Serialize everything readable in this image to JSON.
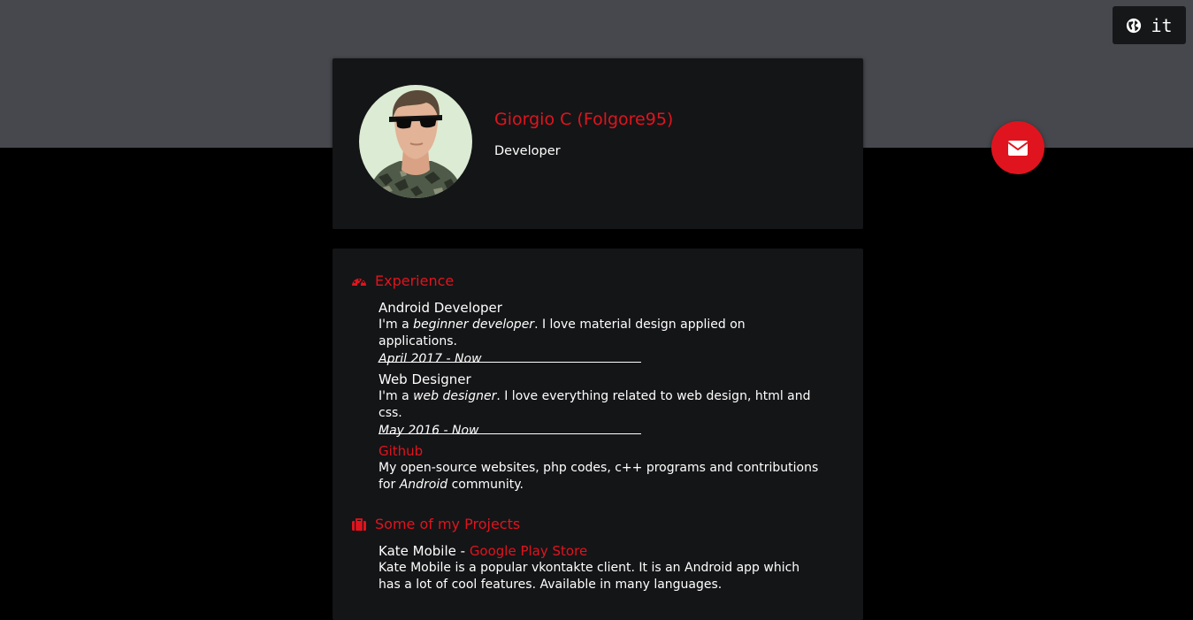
{
  "language": {
    "label": "it",
    "icon": "globe-icon"
  },
  "profile": {
    "name": "Giorgio C (Folgore95)",
    "role": "Developer"
  },
  "contact": {
    "icon": "envelope-icon"
  },
  "experience": {
    "title": "Experience",
    "icon": "dashboard-icon",
    "items": [
      {
        "title": "Android Developer",
        "desc_prefix": "I'm a ",
        "desc_emphasis": "beginner developer",
        "desc_suffix": ". I love material design applied on applications.",
        "date": "April 2017 - Now"
      },
      {
        "title": "Web Designer",
        "desc_prefix": "I'm a ",
        "desc_emphasis": "web designer",
        "desc_suffix": ". I love everything related to web design, html and css.",
        "date": "May 2016 - Now"
      }
    ],
    "github": {
      "label": "Github",
      "desc_prefix": "My open-source websites, php codes, c++ programs and contributions for ",
      "desc_emphasis": "Android",
      "desc_suffix": " community."
    }
  },
  "projects": {
    "title": "Some of my Projects",
    "icon": "briefcase-icon",
    "items": [
      {
        "name": "Kate Mobile",
        "separator": " - ",
        "link": "Google Play Store",
        "desc": "Kate Mobile is a popular vkontakte client. It is an Android app which has a lot of cool features. Available in many languages."
      }
    ]
  },
  "colors": {
    "accent": "#e0141e",
    "header_band": "#46484d",
    "card": "#141517",
    "background": "#000000"
  }
}
